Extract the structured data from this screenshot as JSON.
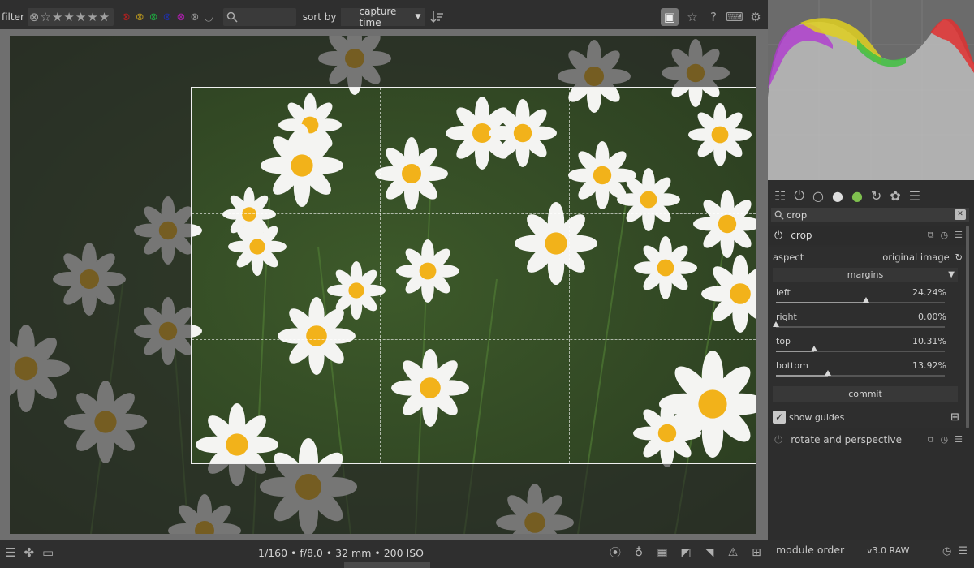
{
  "topbar": {
    "filter_label": "filter",
    "sort_label": "sort by",
    "sort_value": "capture time"
  },
  "exif": "1/160 • f/8.0 • 32 mm • 200 ISO",
  "right_panel": {
    "search_value": "crop",
    "crop_module": {
      "title": "crop",
      "aspect_label": "aspect",
      "aspect_value": "original image",
      "margins_label": "margins",
      "sliders": [
        {
          "label": "left",
          "value_text": "24.24%",
          "value": 24.24
        },
        {
          "label": "right",
          "value_text": "0.00%",
          "value": 0.0
        },
        {
          "label": "top",
          "value_text": "10.31%",
          "value": 10.31
        },
        {
          "label": "bottom",
          "value_text": "13.92%",
          "value": 13.92
        }
      ],
      "commit_label": "commit",
      "show_guides_label": "show guides"
    },
    "next_module_title": "rotate and perspective"
  },
  "bottombar": {
    "module_order_label": "module order",
    "module_order_value": "v3.0 RAW"
  },
  "colors": {
    "label_red": "#b02020",
    "label_yellow": "#b09020",
    "label_green": "#20a040",
    "label_blue": "#2030a0",
    "label_purple": "#a020a0"
  }
}
